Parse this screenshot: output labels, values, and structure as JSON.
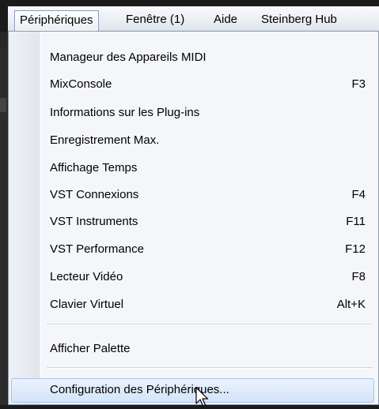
{
  "menubar": {
    "items": [
      {
        "label": "Périphériques",
        "active": true
      },
      {
        "label": "Fenêtre (1)",
        "active": false
      },
      {
        "label": "Aide",
        "active": false
      },
      {
        "label": "Steinberg Hub",
        "active": false
      }
    ]
  },
  "dropdown": {
    "items": [
      {
        "label": "Manageur des Appareils MIDI",
        "shortcut": ""
      },
      {
        "label": "MixConsole",
        "shortcut": "F3"
      },
      {
        "label": "Informations sur les Plug-ins",
        "shortcut": ""
      },
      {
        "label": "Enregistrement Max.",
        "shortcut": ""
      },
      {
        "label": "Affichage Temps",
        "shortcut": ""
      },
      {
        "label": "VST Connexions",
        "shortcut": "F4"
      },
      {
        "label": "VST Instruments",
        "shortcut": "F11"
      },
      {
        "label": "VST Performance",
        "shortcut": "F12"
      },
      {
        "label": "Lecteur Vidéo",
        "shortcut": "F8"
      },
      {
        "label": "Clavier Virtuel",
        "shortcut": "Alt+K"
      },
      {
        "label": "Afficher Palette",
        "shortcut": ""
      },
      {
        "label": "Configuration des Périphériques...",
        "shortcut": "",
        "highlighted": true
      }
    ]
  },
  "colors": {
    "highlight_border": "#a9c3e6",
    "menu_background": "#f4f6f9"
  },
  "icons": {
    "cursor": "mouse-pointer-icon"
  }
}
